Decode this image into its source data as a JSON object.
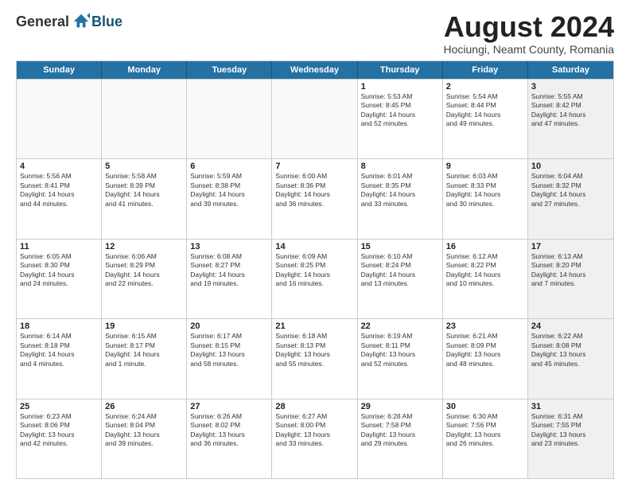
{
  "logo": {
    "general": "General",
    "blue": "Blue"
  },
  "title": "August 2024",
  "subtitle": "Hociungi, Neamt County, Romania",
  "days": [
    "Sunday",
    "Monday",
    "Tuesday",
    "Wednesday",
    "Thursday",
    "Friday",
    "Saturday"
  ],
  "rows": [
    [
      {
        "day": "",
        "info": "",
        "empty": true
      },
      {
        "day": "",
        "info": "",
        "empty": true
      },
      {
        "day": "",
        "info": "",
        "empty": true
      },
      {
        "day": "",
        "info": "",
        "empty": true
      },
      {
        "day": "1",
        "info": "Sunrise: 5:53 AM\nSunset: 8:45 PM\nDaylight: 14 hours\nand 52 minutes."
      },
      {
        "day": "2",
        "info": "Sunrise: 5:54 AM\nSunset: 8:44 PM\nDaylight: 14 hours\nand 49 minutes."
      },
      {
        "day": "3",
        "info": "Sunrise: 5:55 AM\nSunset: 8:42 PM\nDaylight: 14 hours\nand 47 minutes.",
        "shaded": true
      }
    ],
    [
      {
        "day": "4",
        "info": "Sunrise: 5:56 AM\nSunset: 8:41 PM\nDaylight: 14 hours\nand 44 minutes."
      },
      {
        "day": "5",
        "info": "Sunrise: 5:58 AM\nSunset: 8:39 PM\nDaylight: 14 hours\nand 41 minutes."
      },
      {
        "day": "6",
        "info": "Sunrise: 5:59 AM\nSunset: 8:38 PM\nDaylight: 14 hours\nand 39 minutes."
      },
      {
        "day": "7",
        "info": "Sunrise: 6:00 AM\nSunset: 8:36 PM\nDaylight: 14 hours\nand 36 minutes."
      },
      {
        "day": "8",
        "info": "Sunrise: 6:01 AM\nSunset: 8:35 PM\nDaylight: 14 hours\nand 33 minutes."
      },
      {
        "day": "9",
        "info": "Sunrise: 6:03 AM\nSunset: 8:33 PM\nDaylight: 14 hours\nand 30 minutes."
      },
      {
        "day": "10",
        "info": "Sunrise: 6:04 AM\nSunset: 8:32 PM\nDaylight: 14 hours\nand 27 minutes.",
        "shaded": true
      }
    ],
    [
      {
        "day": "11",
        "info": "Sunrise: 6:05 AM\nSunset: 8:30 PM\nDaylight: 14 hours\nand 24 minutes."
      },
      {
        "day": "12",
        "info": "Sunrise: 6:06 AM\nSunset: 8:29 PM\nDaylight: 14 hours\nand 22 minutes."
      },
      {
        "day": "13",
        "info": "Sunrise: 6:08 AM\nSunset: 8:27 PM\nDaylight: 14 hours\nand 19 minutes."
      },
      {
        "day": "14",
        "info": "Sunrise: 6:09 AM\nSunset: 8:25 PM\nDaylight: 14 hours\nand 16 minutes."
      },
      {
        "day": "15",
        "info": "Sunrise: 6:10 AM\nSunset: 8:24 PM\nDaylight: 14 hours\nand 13 minutes."
      },
      {
        "day": "16",
        "info": "Sunrise: 6:12 AM\nSunset: 8:22 PM\nDaylight: 14 hours\nand 10 minutes."
      },
      {
        "day": "17",
        "info": "Sunrise: 6:13 AM\nSunset: 8:20 PM\nDaylight: 14 hours\nand 7 minutes.",
        "shaded": true
      }
    ],
    [
      {
        "day": "18",
        "info": "Sunrise: 6:14 AM\nSunset: 8:18 PM\nDaylight: 14 hours\nand 4 minutes."
      },
      {
        "day": "19",
        "info": "Sunrise: 6:15 AM\nSunset: 8:17 PM\nDaylight: 14 hours\nand 1 minute."
      },
      {
        "day": "20",
        "info": "Sunrise: 6:17 AM\nSunset: 8:15 PM\nDaylight: 13 hours\nand 58 minutes."
      },
      {
        "day": "21",
        "info": "Sunrise: 6:18 AM\nSunset: 8:13 PM\nDaylight: 13 hours\nand 55 minutes."
      },
      {
        "day": "22",
        "info": "Sunrise: 6:19 AM\nSunset: 8:11 PM\nDaylight: 13 hours\nand 52 minutes."
      },
      {
        "day": "23",
        "info": "Sunrise: 6:21 AM\nSunset: 8:09 PM\nDaylight: 13 hours\nand 48 minutes."
      },
      {
        "day": "24",
        "info": "Sunrise: 6:22 AM\nSunset: 8:08 PM\nDaylight: 13 hours\nand 45 minutes.",
        "shaded": true
      }
    ],
    [
      {
        "day": "25",
        "info": "Sunrise: 6:23 AM\nSunset: 8:06 PM\nDaylight: 13 hours\nand 42 minutes."
      },
      {
        "day": "26",
        "info": "Sunrise: 6:24 AM\nSunset: 8:04 PM\nDaylight: 13 hours\nand 39 minutes."
      },
      {
        "day": "27",
        "info": "Sunrise: 6:26 AM\nSunset: 8:02 PM\nDaylight: 13 hours\nand 36 minutes."
      },
      {
        "day": "28",
        "info": "Sunrise: 6:27 AM\nSunset: 8:00 PM\nDaylight: 13 hours\nand 33 minutes."
      },
      {
        "day": "29",
        "info": "Sunrise: 6:28 AM\nSunset: 7:58 PM\nDaylight: 13 hours\nand 29 minutes."
      },
      {
        "day": "30",
        "info": "Sunrise: 6:30 AM\nSunset: 7:56 PM\nDaylight: 13 hours\nand 26 minutes."
      },
      {
        "day": "31",
        "info": "Sunrise: 6:31 AM\nSunset: 7:55 PM\nDaylight: 13 hours\nand 23 minutes.",
        "shaded": true
      }
    ]
  ]
}
